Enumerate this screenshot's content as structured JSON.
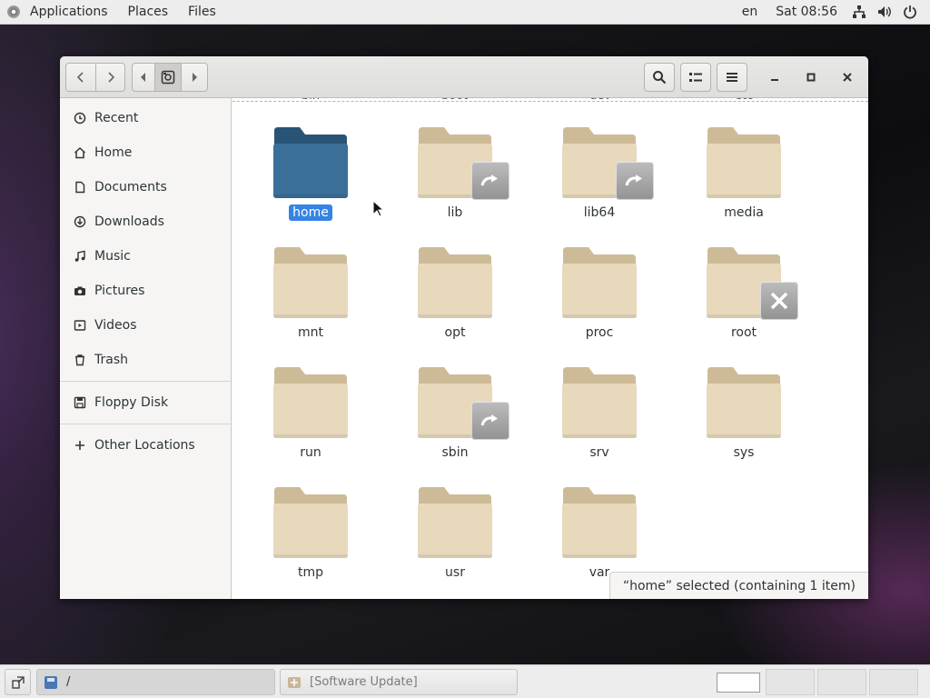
{
  "topbar": {
    "applications": "Applications",
    "places": "Places",
    "files": "Files",
    "language": "en",
    "clock": "Sat 08:56"
  },
  "sidebar": {
    "items": [
      {
        "label": "Recent",
        "icon": "clock-icon"
      },
      {
        "label": "Home",
        "icon": "home-icon"
      },
      {
        "label": "Documents",
        "icon": "document-icon"
      },
      {
        "label": "Downloads",
        "icon": "download-icon"
      },
      {
        "label": "Music",
        "icon": "music-icon"
      },
      {
        "label": "Pictures",
        "icon": "camera-icon"
      },
      {
        "label": "Videos",
        "icon": "video-icon"
      },
      {
        "label": "Trash",
        "icon": "trash-icon"
      }
    ],
    "devices": [
      {
        "label": "Floppy Disk",
        "icon": "floppy-icon"
      }
    ],
    "other": {
      "label": "Other Locations",
      "icon": "plus-icon"
    }
  },
  "main": {
    "cut_row": [
      "bin",
      "boot",
      "dev",
      "etc"
    ],
    "folders": [
      {
        "name": "home",
        "selected": true,
        "emblem": ""
      },
      {
        "name": "lib",
        "selected": false,
        "emblem": "symlink"
      },
      {
        "name": "lib64",
        "selected": false,
        "emblem": "symlink"
      },
      {
        "name": "media",
        "selected": false,
        "emblem": ""
      },
      {
        "name": "mnt",
        "selected": false,
        "emblem": ""
      },
      {
        "name": "opt",
        "selected": false,
        "emblem": ""
      },
      {
        "name": "proc",
        "selected": false,
        "emblem": ""
      },
      {
        "name": "root",
        "selected": false,
        "emblem": "no-access"
      },
      {
        "name": "run",
        "selected": false,
        "emblem": ""
      },
      {
        "name": "sbin",
        "selected": false,
        "emblem": "symlink"
      },
      {
        "name": "srv",
        "selected": false,
        "emblem": ""
      },
      {
        "name": "sys",
        "selected": false,
        "emblem": ""
      },
      {
        "name": "tmp",
        "selected": false,
        "emblem": ""
      },
      {
        "name": "usr",
        "selected": false,
        "emblem": ""
      },
      {
        "name": "var",
        "selected": false,
        "emblem": ""
      }
    ],
    "status": "“home” selected  (containing 1 item)"
  },
  "taskbar": {
    "files_task": "/",
    "update_task": "[Software Update]"
  },
  "colors": {
    "accent": "#3584e4",
    "folder": "#e8d9bd",
    "folder_tab": "#cdbb98",
    "folder_selected": "#3a6f9a",
    "folder_selected_tab": "#2a5476"
  }
}
